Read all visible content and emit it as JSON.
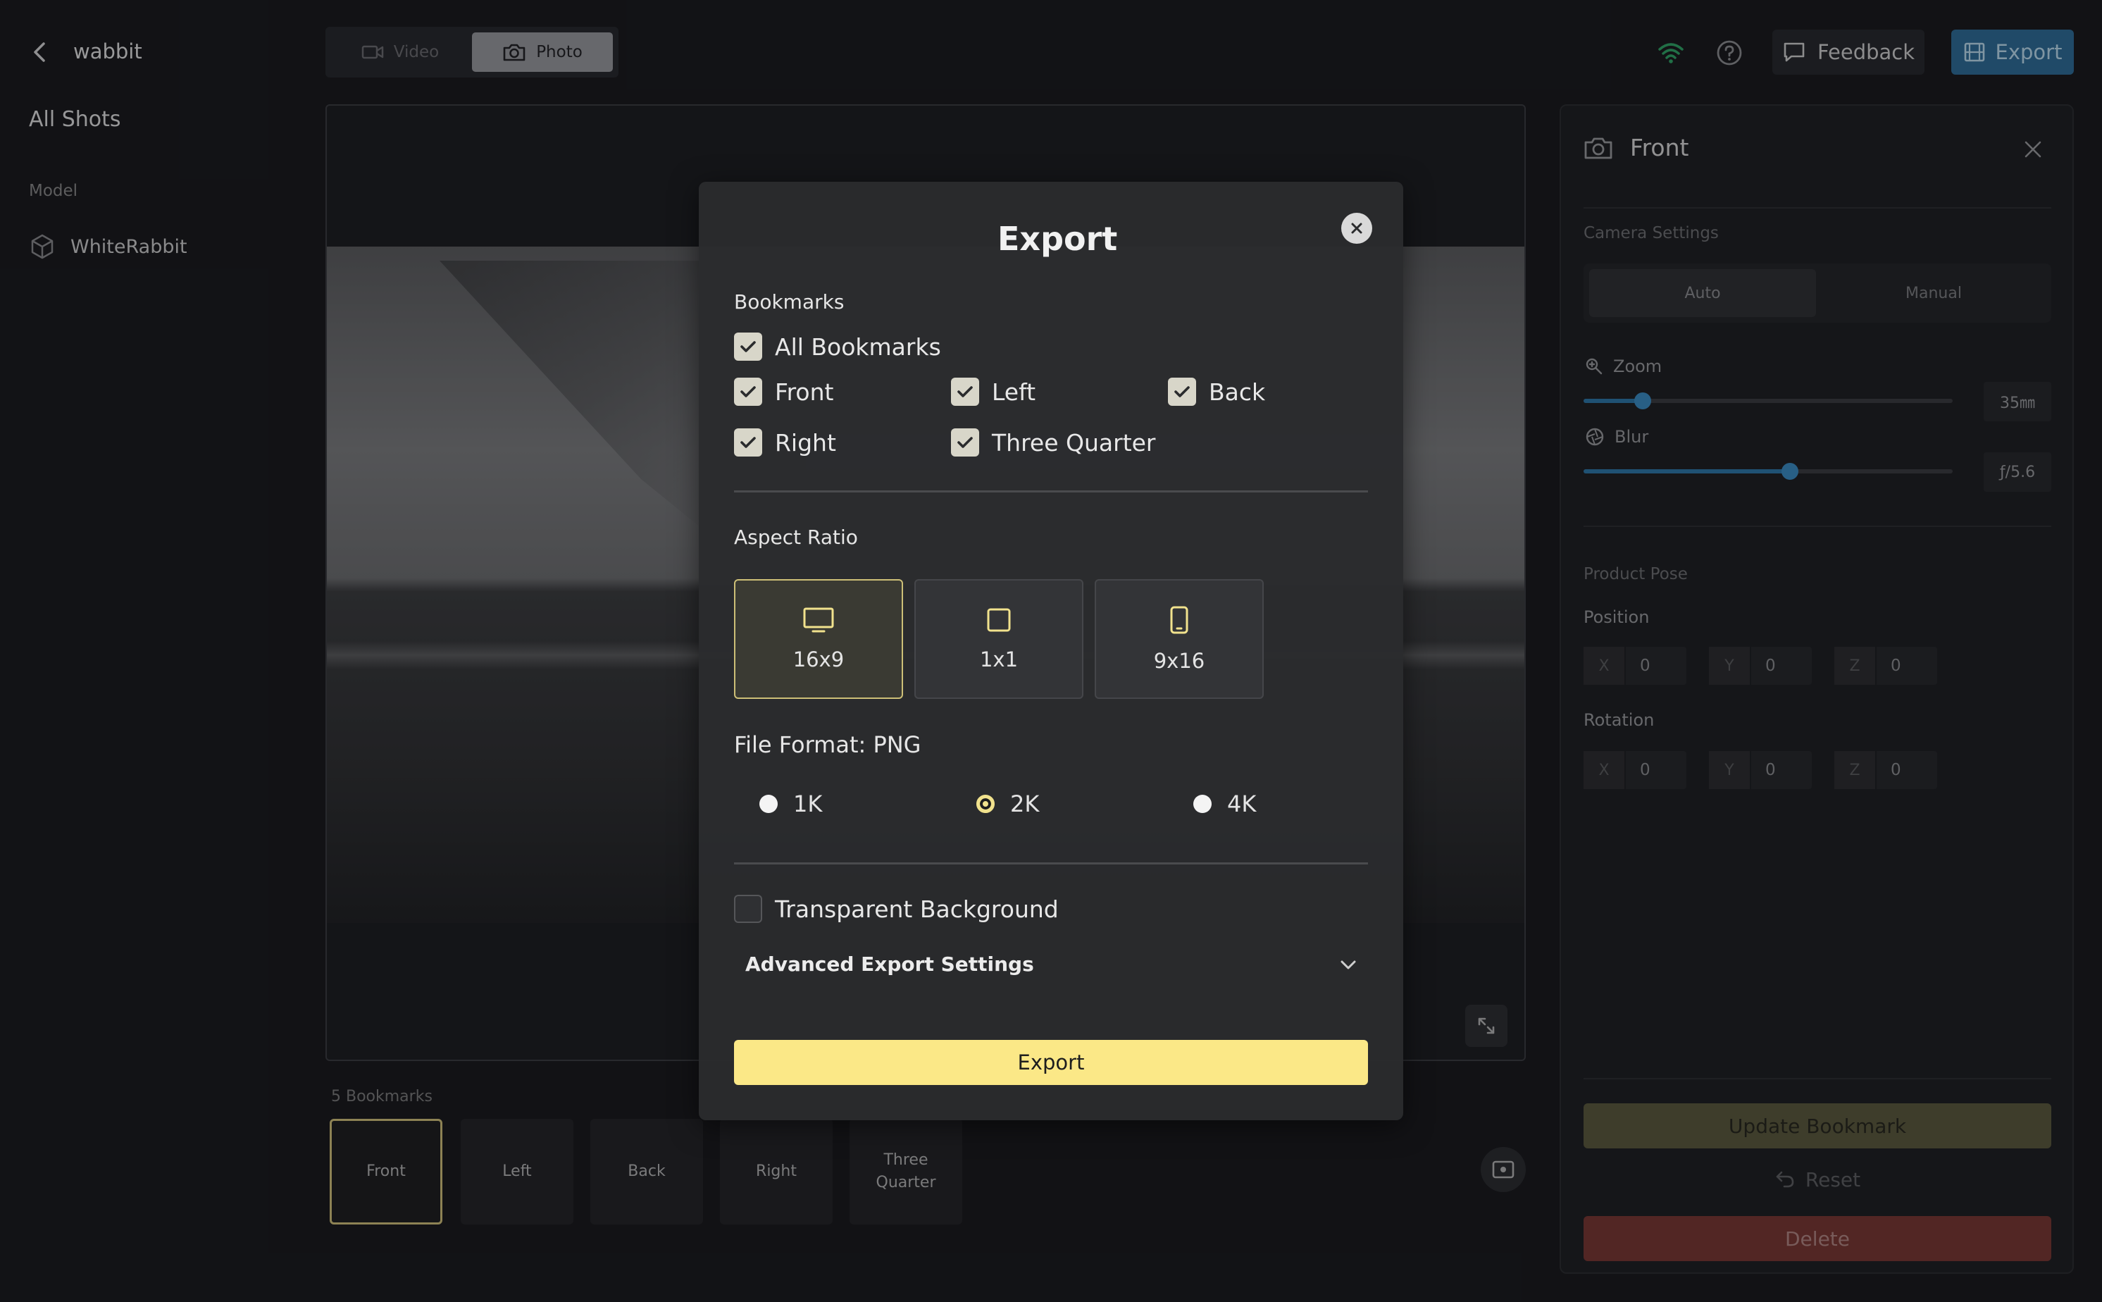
{
  "app": {
    "project_name": "wabbit",
    "all_shots": "All Shots",
    "model_label": "Model",
    "model_name": "WhiteRabbit"
  },
  "toolbar": {
    "modes": [
      {
        "label": "Video",
        "active": false
      },
      {
        "label": "Photo",
        "active": true
      }
    ],
    "feedback_label": "Feedback",
    "export_label": "Export",
    "icons": [
      "wifi-icon",
      "help-icon",
      "feedback-icon",
      "export-icon"
    ]
  },
  "bookmarks": {
    "count_label": "5 Bookmarks",
    "items": [
      {
        "label": "Front",
        "active": true
      },
      {
        "label": "Left",
        "active": false
      },
      {
        "label": "Back",
        "active": false
      },
      {
        "label": "Right",
        "active": false
      },
      {
        "label": "Three Quarter",
        "active": false
      }
    ]
  },
  "panel": {
    "title": "Front",
    "camera_settings_label": "Camera Settings",
    "camera_modes": [
      "Auto",
      "Manual"
    ],
    "zoom": {
      "label": "Zoom",
      "value": "35㎜",
      "level": 0.16
    },
    "blur": {
      "label": "Blur",
      "value": "ƒ/5.6",
      "level": 0.56
    },
    "product_pose_label": "Product Pose",
    "position": {
      "label": "Position",
      "x": "0",
      "y": "0",
      "z": "0"
    },
    "rotation": {
      "label": "Rotation",
      "x": "0",
      "y": "0",
      "z": "0"
    },
    "axes": [
      "X",
      "Y",
      "Z"
    ],
    "update_label": "Update Bookmark",
    "reset_label": "Reset",
    "delete_label": "Delete"
  },
  "modal": {
    "title": "Export",
    "bookmarks_label": "Bookmarks",
    "all_bookmarks": {
      "label": "All Bookmarks",
      "checked": true
    },
    "bookmark_options": [
      {
        "label": "Front",
        "checked": true
      },
      {
        "label": "Left",
        "checked": true
      },
      {
        "label": "Back",
        "checked": true
      },
      {
        "label": "Right",
        "checked": true
      },
      {
        "label": "Three Quarter",
        "checked": true
      }
    ],
    "aspect_ratio_label": "Aspect Ratio",
    "aspect_ratios": [
      {
        "label": "16x9",
        "icon": "monitor-icon",
        "selected": true
      },
      {
        "label": "1x1",
        "icon": "square-icon",
        "selected": false
      },
      {
        "label": "9x16",
        "icon": "phone-icon",
        "selected": false
      }
    ],
    "file_format_label": "File Format: PNG",
    "resolutions": [
      {
        "label": "1K",
        "selected": false
      },
      {
        "label": "2K",
        "selected": true
      },
      {
        "label": "4K",
        "selected": false
      }
    ],
    "transparent_label": "Transparent Background",
    "transparent_checked": false,
    "advanced_label": "Advanced Export Settings",
    "export_label": "Export"
  },
  "colors": {
    "accent_yellow": "#fbe887",
    "accent_blue": "#2d6d9a",
    "delete_red": "#7a3732"
  }
}
